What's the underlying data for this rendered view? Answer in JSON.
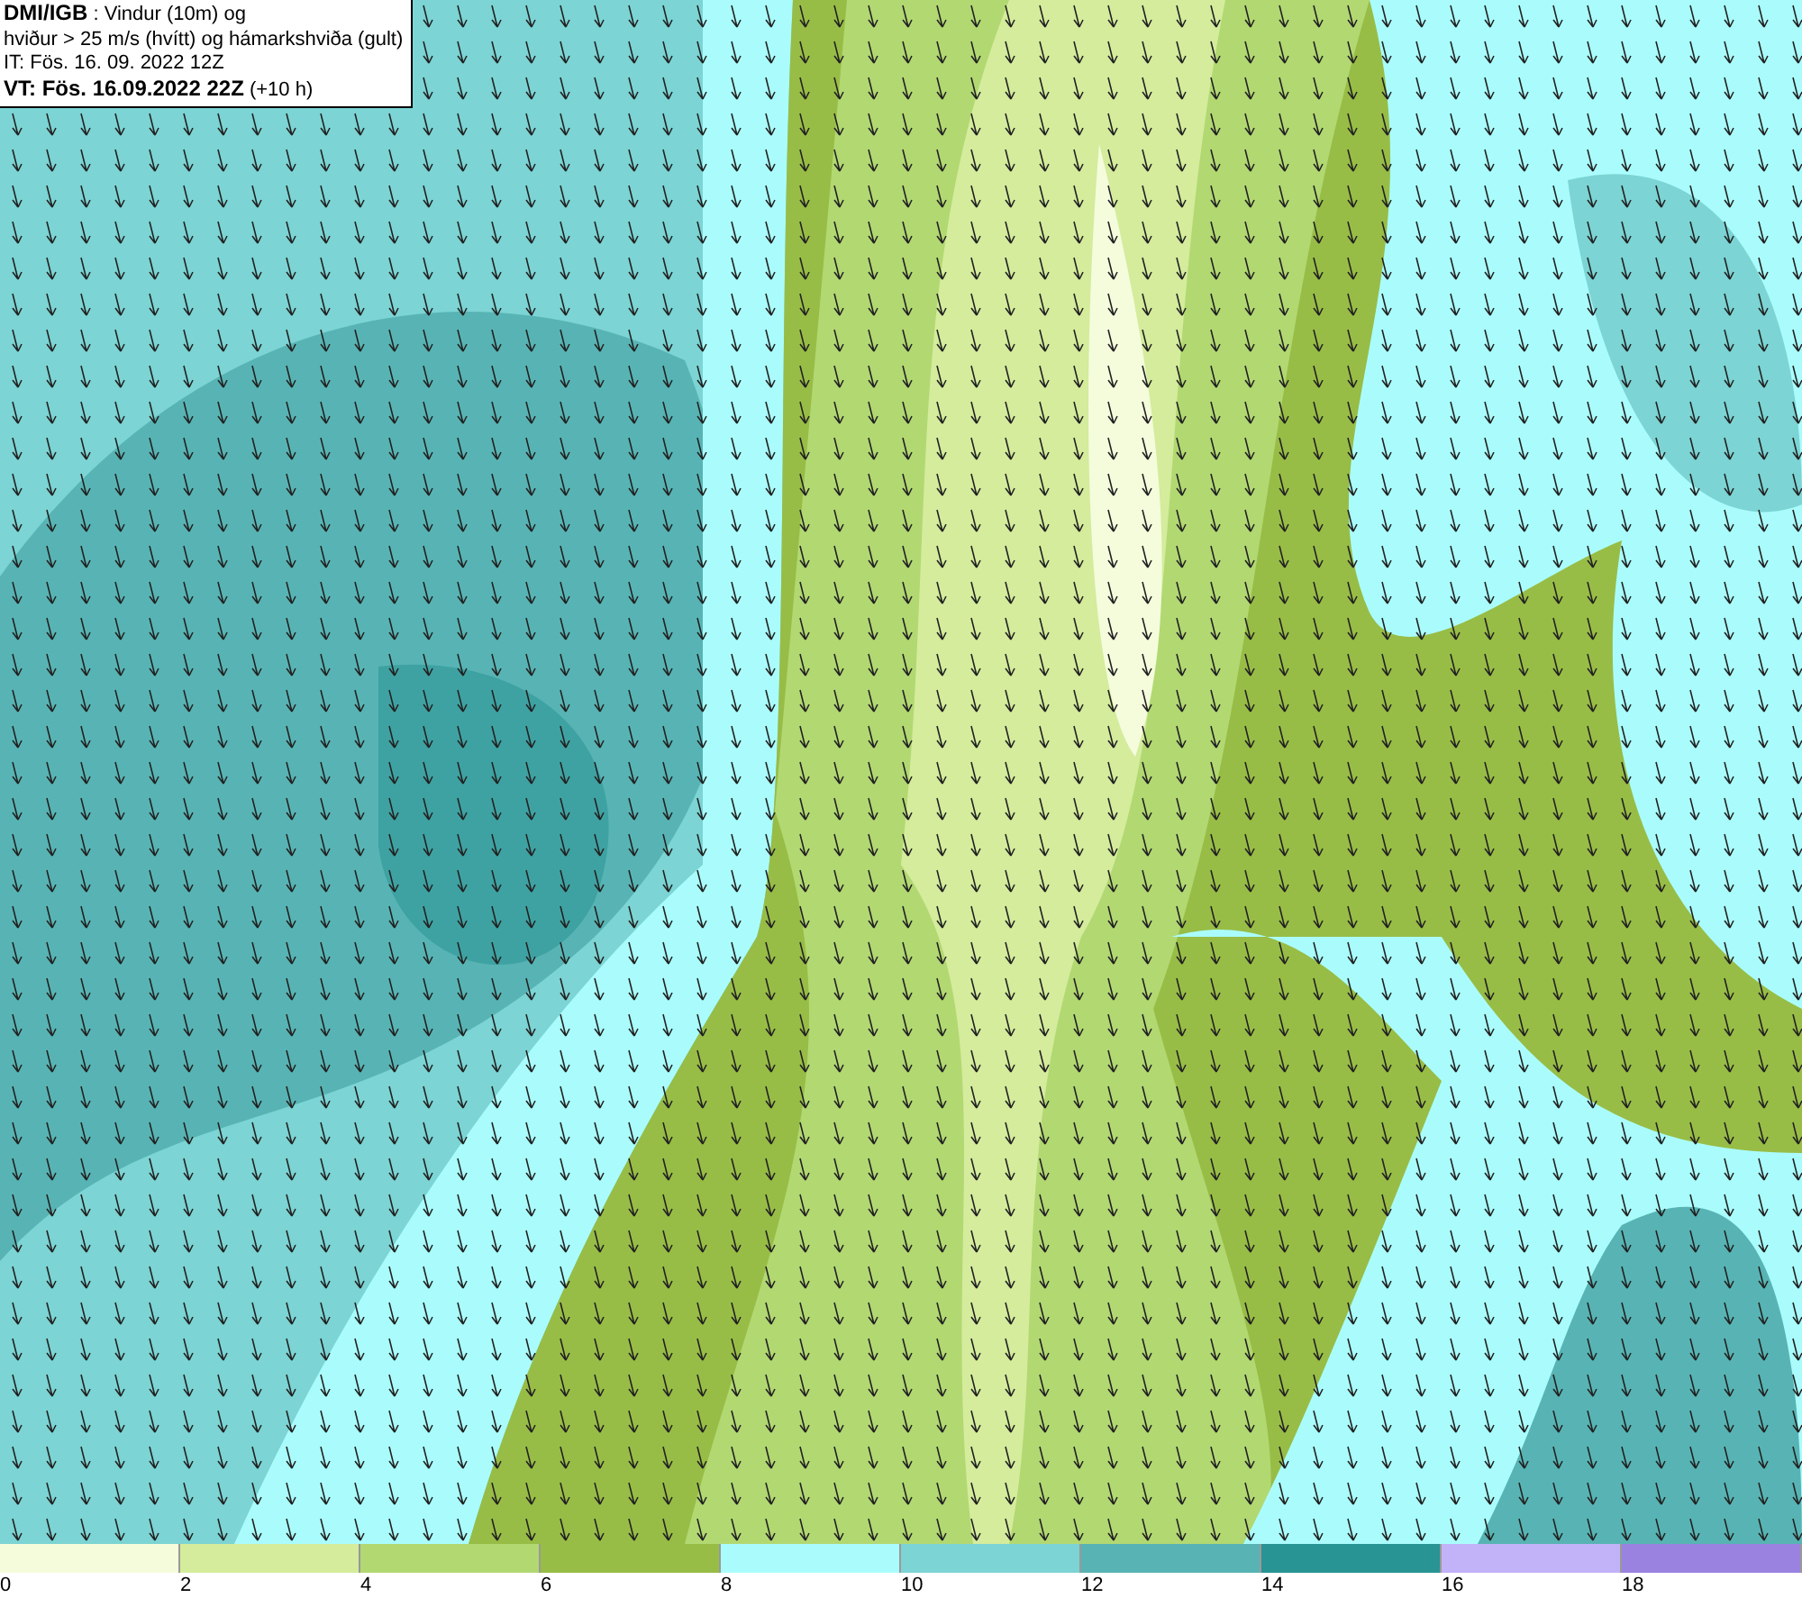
{
  "info_box": {
    "lines": [
      {
        "text": "**DMI/IGB** : Vindur (10m) og"
      },
      {
        "text": "hviður > 25 m/s (hvítt) og hámarkshviða (gult)"
      },
      {
        "text": "IT: Fös. 16. 09. 2022 12Z"
      },
      {
        "text": "**VT: Fös. 16.09.2022 22Z** (+10 h)"
      }
    ]
  },
  "legend": {
    "bins": [
      {
        "color": "#f4fcdc"
      },
      {
        "color": "#d4ec9c"
      },
      {
        "color": "#b2d872"
      },
      {
        "color": "#98bd46"
      },
      {
        "color": "#aafcfc"
      },
      {
        "color": "#7cd4d4"
      },
      {
        "color": "#58b4b4"
      },
      {
        "color": "#289494"
      },
      {
        "color": "#c2b2f8"
      },
      {
        "color": "#9a82e0"
      }
    ],
    "ticks": [
      "0",
      "2",
      "4",
      "6",
      "8",
      "10",
      "12",
      "14",
      "16",
      "18"
    ]
  }
}
